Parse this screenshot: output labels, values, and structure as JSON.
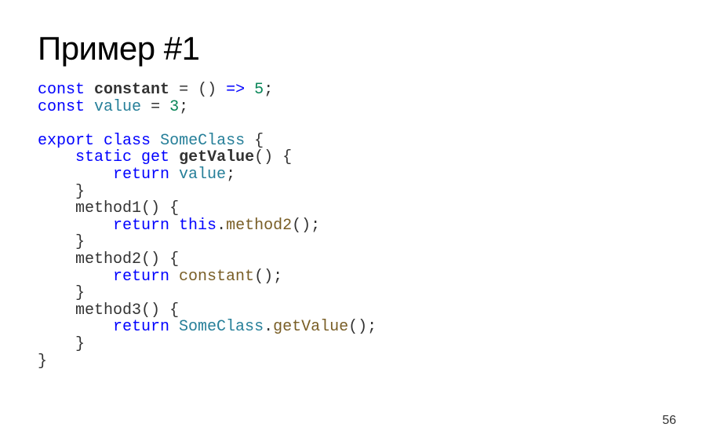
{
  "slide": {
    "title": "Пример #1",
    "page_number": "56"
  },
  "code": {
    "line1": {
      "kw_const": "const",
      "name": "constant",
      "eq": "=",
      "paren_open": "(",
      "paren_close": ")",
      "arrow": "=>",
      "num": "5",
      "semi": ";"
    },
    "line2": {
      "kw_const": "const",
      "name": "value",
      "eq": "=",
      "num": "3",
      "semi": ";"
    },
    "line3": {
      "kw_export": "export",
      "kw_class": "class",
      "name": "SomeClass",
      "brace": "{"
    },
    "line4": {
      "kw_static": "static",
      "kw_get": "get",
      "name": "getValue",
      "parens": "()",
      "brace": "{"
    },
    "line5": {
      "kw_return": "return",
      "name": "value",
      "semi": ";"
    },
    "line6": {
      "brace": "}"
    },
    "line7": {
      "name": "method1",
      "parens": "()",
      "brace": "{"
    },
    "line8": {
      "kw_return": "return",
      "kw_this": "this",
      "dot": ".",
      "call": "method2",
      "parens": "()",
      "semi": ";"
    },
    "line9": {
      "brace": "}"
    },
    "line10": {
      "name": "method2",
      "parens": "()",
      "brace": "{"
    },
    "line11": {
      "kw_return": "return",
      "call": "constant",
      "parens": "()",
      "semi": ";"
    },
    "line12": {
      "brace": "}"
    },
    "line13": {
      "name": "method3",
      "parens": "()",
      "brace": "{"
    },
    "line14": {
      "kw_return": "return",
      "class": "SomeClass",
      "dot": ".",
      "call": "getValue",
      "parens": "()",
      "semi": ";"
    },
    "line15": {
      "brace": "}"
    },
    "line16": {
      "brace": "}"
    }
  }
}
